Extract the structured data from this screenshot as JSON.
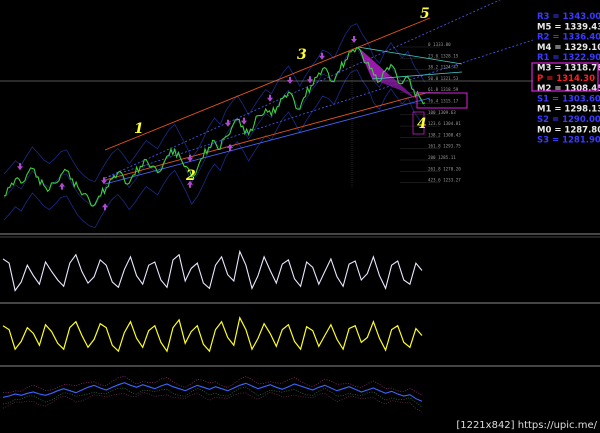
{
  "watermark": "[1221x842] https://upic.me/",
  "colors": {
    "background": "#000000",
    "candles": "#3ecf3e",
    "rsi": "#e8e8ff",
    "stoch": "#ffff1a",
    "indicator3": "#3a66ff",
    "channel_orange": "#e2541c",
    "channel_blue": "#4466ff",
    "harmonic": "#b51ccb",
    "highlight": "#dd22dd",
    "pivot_blue": "#3a3aff",
    "pivot_white": "#e8e8e8",
    "pivot_red": "#ff2020"
  },
  "pivot_levels": [
    {
      "label": "R3 = 1343.00",
      "kind": "blue"
    },
    {
      "label": "M5 = 1339.43",
      "kind": "white"
    },
    {
      "label": "R2 = 1336.40",
      "kind": "blue"
    },
    {
      "label": "M4 = 1329.10",
      "kind": "white"
    },
    {
      "label": "R1 = 1322.90",
      "kind": "blue"
    },
    {
      "label": "M3 = 1318.78",
      "kind": "white"
    },
    {
      "label": "P = 1314.30",
      "kind": "red"
    },
    {
      "label": "M2 = 1308.45",
      "kind": "white"
    },
    {
      "label": "S1 = 1303.60",
      "kind": "blue"
    },
    {
      "label": "M1 = 1298.13",
      "kind": "white"
    },
    {
      "label": "S2 = 1290.00",
      "kind": "blue"
    },
    {
      "label": "M0 = 1287.80",
      "kind": "white"
    },
    {
      "label": "S3 = 1281.90",
      "kind": "blue"
    }
  ],
  "wave_labels": [
    "1",
    "2",
    "3",
    "4",
    "5"
  ],
  "fib_levels": [
    "0  1333.80",
    "23.6 1328.15",
    "38.2 1324.47",
    "50.0 1321.53",
    "61.8 1318.59",
    "76.4 1315.17",
    "100 1309.63",
    "123.6 1304.81",
    "138.2 1300.43",
    "161.8 1293.75",
    "200 1285.11",
    "261.8 1270.20",
    "423.6 1233.27"
  ],
  "chart_data": {
    "type": "line",
    "title": "",
    "xlabel": "",
    "ylabel": "",
    "price_close": [
      1262,
      1266,
      1270,
      1268,
      1272,
      1275,
      1271,
      1267,
      1265,
      1268,
      1272,
      1274,
      1270,
      1266,
      1263,
      1260,
      1258,
      1262,
      1266,
      1270,
      1273,
      1271,
      1268,
      1272,
      1276,
      1279,
      1276,
      1273,
      1277,
      1281,
      1284,
      1280,
      1276,
      1271,
      1275,
      1280,
      1285,
      1288,
      1284,
      1290,
      1294,
      1298,
      1295,
      1291,
      1296,
      1300,
      1303,
      1300,
      1304,
      1308,
      1311,
      1307,
      1303,
      1309,
      1314,
      1318,
      1322,
      1320,
      1316,
      1321,
      1326,
      1330,
      1332,
      1328,
      1325,
      1319,
      1316,
      1321,
      1324,
      1319,
      1315,
      1318,
      1312,
      1309,
      1306
    ],
    "price_ylim": [
      1245,
      1345
    ],
    "panes": [
      {
        "name": "",
        "values": [
          64,
          60,
          34,
          42,
          58,
          48,
          40,
          61,
          52,
          44,
          38,
          60,
          68,
          52,
          41,
          47,
          63,
          58,
          42,
          37,
          54,
          66,
          48,
          40,
          58,
          61,
          44,
          37,
          63,
          68,
          43,
          55,
          60,
          41,
          36,
          58,
          66,
          49,
          43,
          71,
          58,
          36,
          48,
          66,
          53,
          41,
          59,
          63,
          45,
          38,
          61,
          56,
          40,
          52,
          64,
          47,
          38,
          59,
          62,
          44,
          50,
          66,
          48,
          36,
          58,
          62,
          44,
          40,
          60,
          53
        ],
        "ylim": [
          25,
          80
        ]
      },
      {
        "name": "",
        "values": [
          62,
          58,
          38,
          46,
          60,
          54,
          42,
          63,
          56,
          44,
          38,
          60,
          66,
          52,
          40,
          48,
          64,
          60,
          42,
          36,
          55,
          66,
          49,
          40,
          57,
          62,
          45,
          36,
          60,
          68,
          44,
          56,
          62,
          43,
          36,
          58,
          66,
          50,
          42,
          70,
          58,
          38,
          49,
          64,
          54,
          41,
          58,
          63,
          46,
          38,
          61,
          57,
          41,
          52,
          63,
          48,
          38,
          59,
          62,
          45,
          50,
          66,
          49,
          37,
          58,
          62,
          45,
          40,
          59,
          52
        ],
        "ylim": [
          25,
          80
        ]
      },
      {
        "name": "",
        "values": [
          42,
          44,
          47,
          45,
          48,
          50,
          47,
          45,
          48,
          52,
          55,
          52,
          49,
          53,
          57,
          60,
          56,
          53,
          57,
          61,
          64,
          60,
          57,
          61,
          58,
          55,
          59,
          62,
          58,
          55,
          52,
          56,
          60,
          57,
          54,
          58,
          55,
          52,
          56,
          60,
          63,
          59,
          55,
          58,
          61,
          57,
          54,
          58,
          62,
          59,
          56,
          53,
          57,
          60,
          56,
          52,
          55,
          58,
          54,
          50,
          53,
          56,
          52,
          48,
          51,
          47,
          44,
          46,
          40,
          36
        ],
        "ylim": [
          20,
          80
        ]
      }
    ]
  }
}
